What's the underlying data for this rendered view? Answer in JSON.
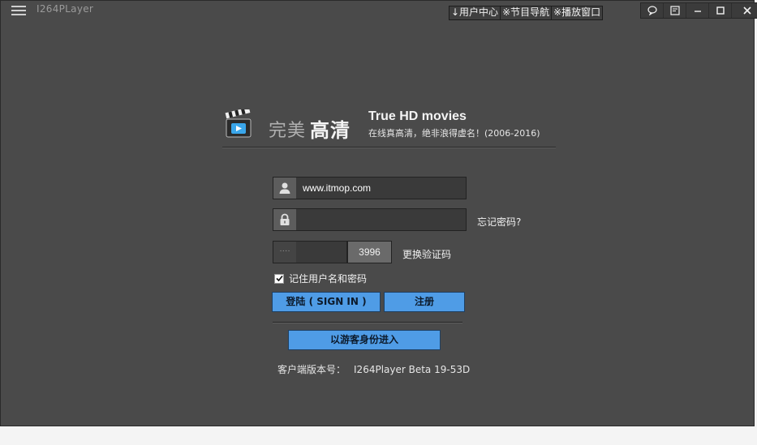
{
  "app": {
    "title": "I264PLayer"
  },
  "top_nav": [
    {
      "label": "↓用户中心"
    },
    {
      "label": "※节目导航"
    },
    {
      "label": "※播放窗口"
    }
  ],
  "window_controls": [
    "feedback-icon",
    "settings-icon",
    "minimize-icon",
    "maximize-icon",
    "close-icon"
  ],
  "logo": {
    "small_text": "完美",
    "big_text": "高清"
  },
  "tagline": {
    "en": "True HD movies",
    "cn": "在线真高清，绝非浪得虚名！(2006-2016)"
  },
  "login": {
    "username_value": "www.itmop.com",
    "password_value": "",
    "forgot_password": "忘记密码?",
    "captcha_dots": "····",
    "captcha_code": "3996",
    "change_captcha": "更换验证码",
    "remember_label": "记住用户名和密码",
    "remember_checked": true,
    "sign_in": "登陆 ( SIGN IN )",
    "register": "注册",
    "guest": "以游客身份进入"
  },
  "version": {
    "label": "客户端版本号：",
    "value": "I264Player Beta 19-53D"
  },
  "colors": {
    "background": "#4a4a4a",
    "button": "#4f9ce6"
  }
}
